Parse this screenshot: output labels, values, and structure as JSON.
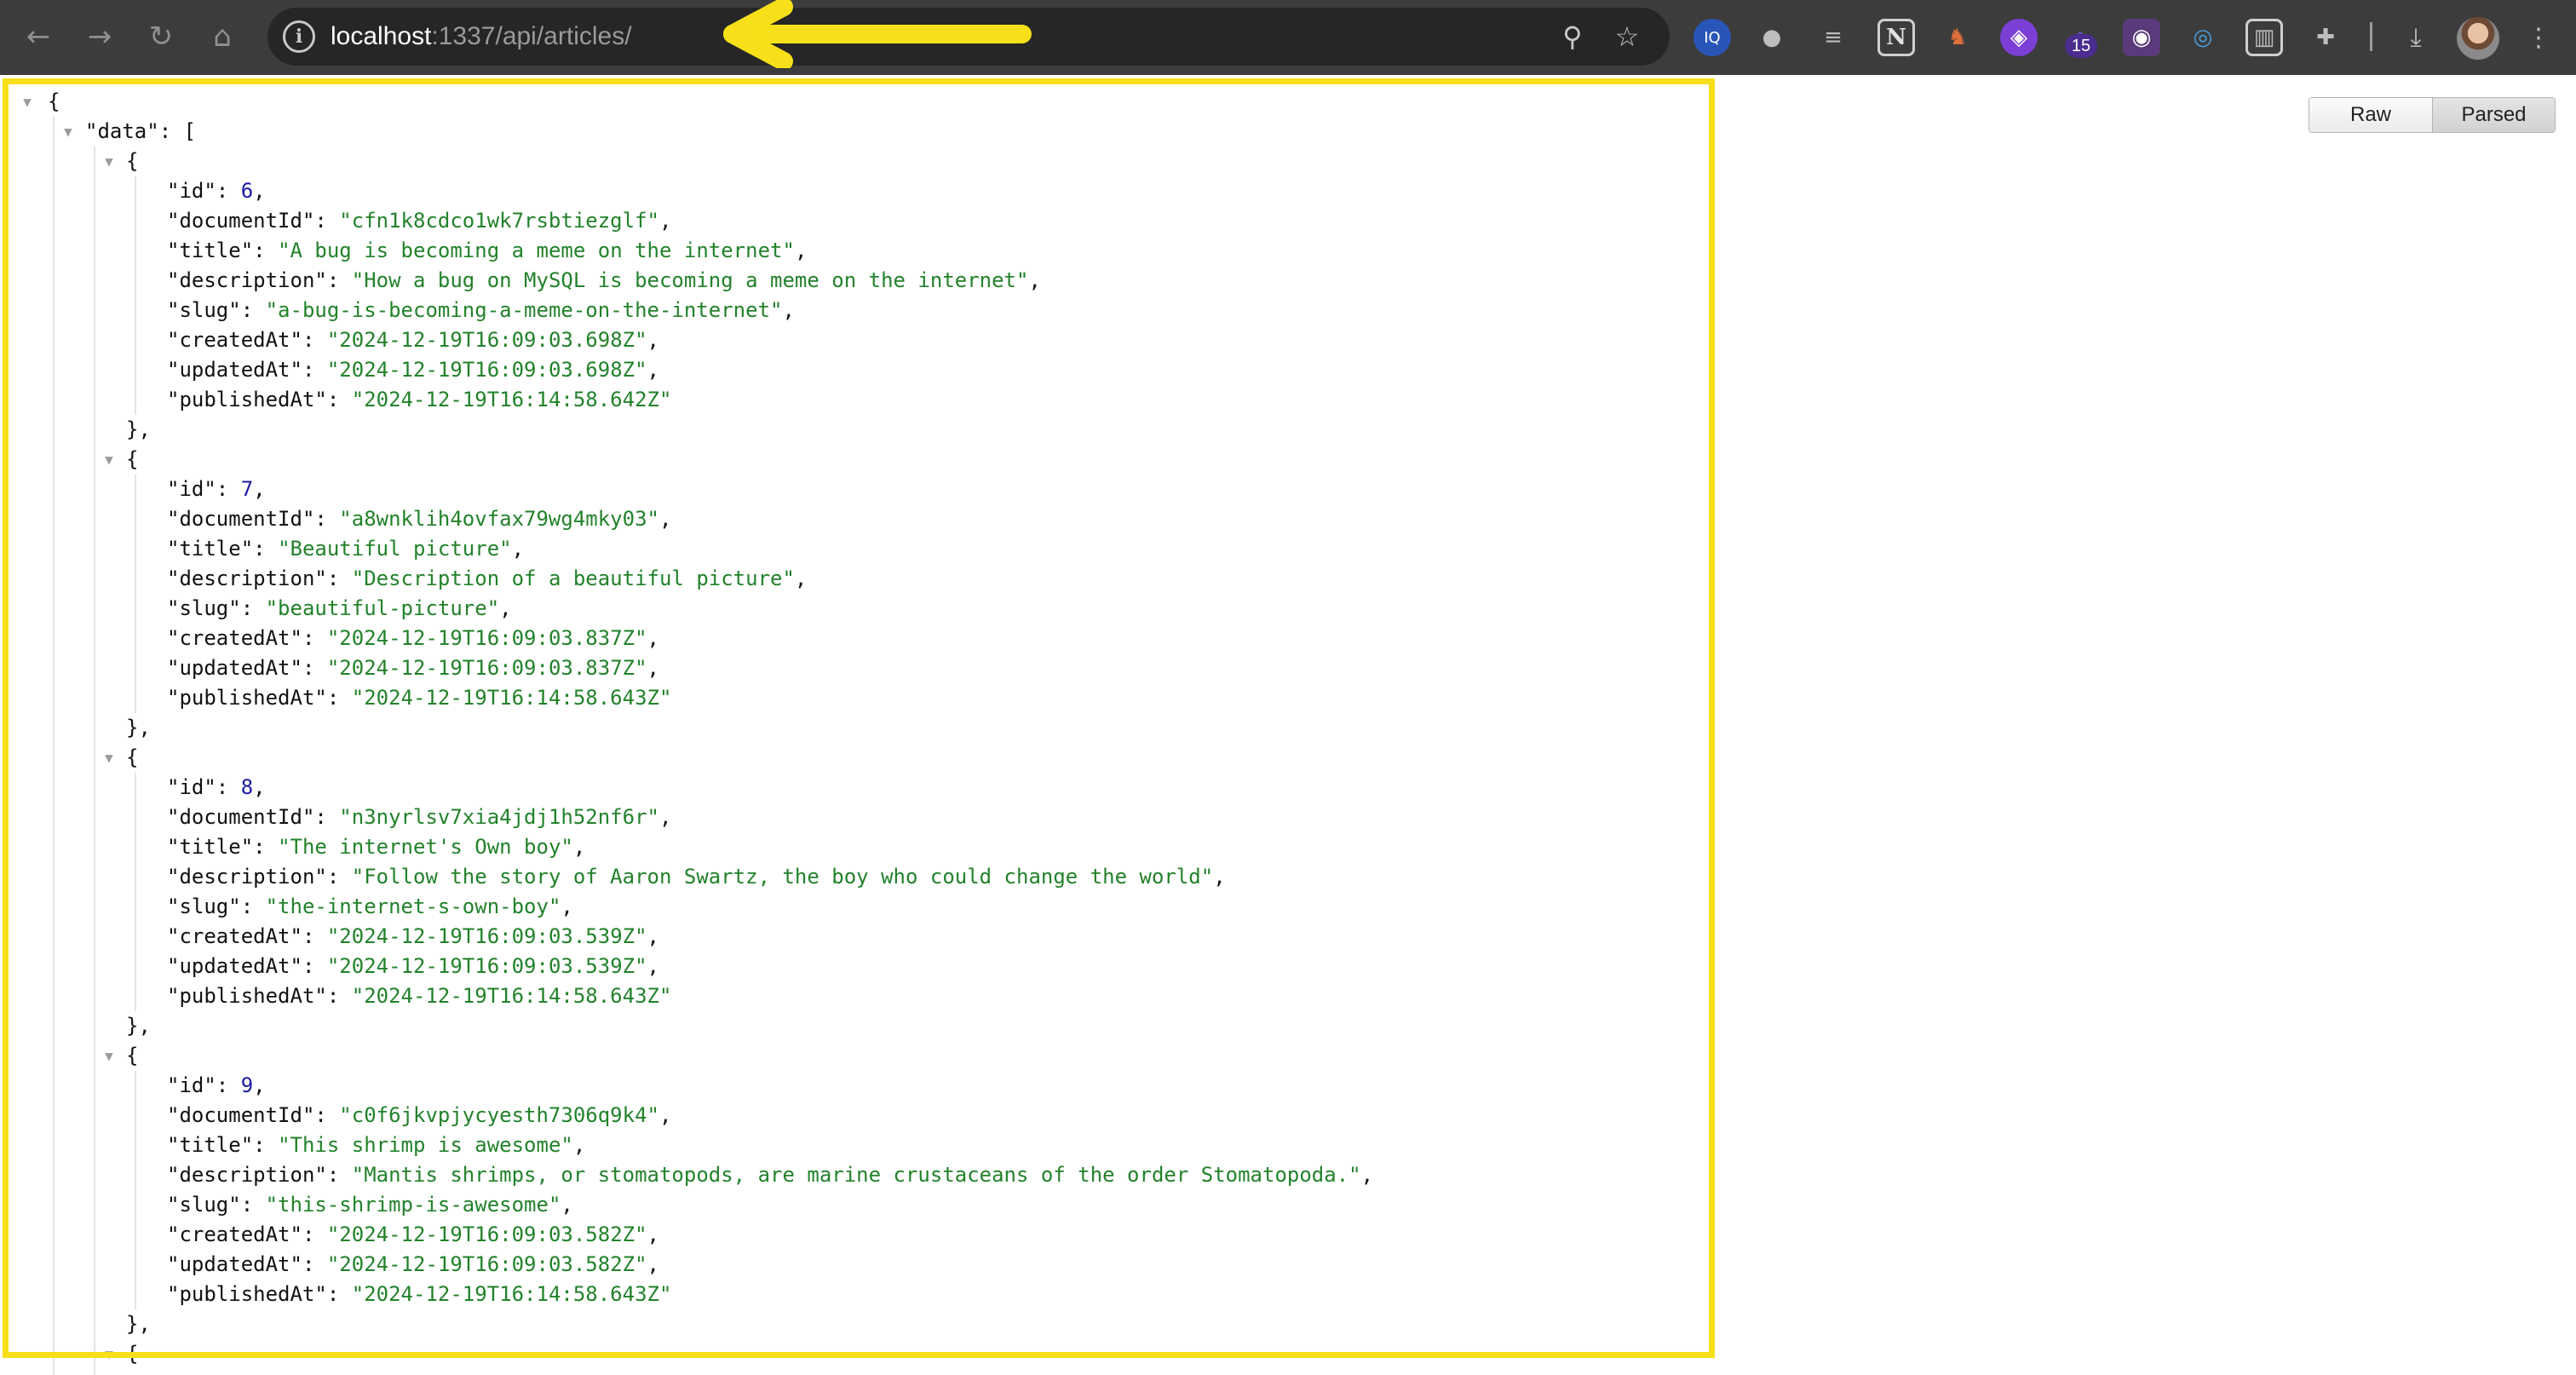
{
  "browser": {
    "url_host": "localhost",
    "url_path": ":1337/api/articles/",
    "extension_badge": "15",
    "nav_icons": [
      "back-arrow-icon",
      "forward-arrow-icon",
      "reload-icon",
      "home-icon"
    ],
    "colors": {
      "toolbar": "#3c3c3c",
      "omnibox": "#262626",
      "annotation": "#f7e019"
    }
  },
  "viewer": {
    "raw_label": "Raw",
    "parsed_label": "Parsed",
    "active_mode": "Parsed"
  },
  "json": {
    "open_brace": "{",
    "data_key": "\"data\"",
    "data_open": ": [",
    "articles": [
      {
        "id": "6",
        "documentId": "\"cfn1k8cdco1wk7rsbtiezglf\"",
        "title": "\"A bug is becoming a meme on the internet\"",
        "description": "\"How a bug on MySQL is becoming a meme on the internet\"",
        "slug": "\"a-bug-is-becoming-a-meme-on-the-internet\"",
        "createdAt": "\"2024-12-19T16:09:03.698Z\"",
        "updatedAt": "\"2024-12-19T16:09:03.698Z\"",
        "publishedAt": "\"2024-12-19T16:14:58.642Z\""
      },
      {
        "id": "7",
        "documentId": "\"a8wnklih4ovfax79wg4mky03\"",
        "title": "\"Beautiful picture\"",
        "description": "\"Description of a beautiful picture\"",
        "slug": "\"beautiful-picture\"",
        "createdAt": "\"2024-12-19T16:09:03.837Z\"",
        "updatedAt": "\"2024-12-19T16:09:03.837Z\"",
        "publishedAt": "\"2024-12-19T16:14:58.643Z\""
      },
      {
        "id": "8",
        "documentId": "\"n3nyrlsv7xia4jdj1h52nf6r\"",
        "title": "\"The internet's Own boy\"",
        "description": "\"Follow the story of Aaron Swartz, the boy who could change the world\"",
        "slug": "\"the-internet-s-own-boy\"",
        "createdAt": "\"2024-12-19T16:09:03.539Z\"",
        "updatedAt": "\"2024-12-19T16:09:03.539Z\"",
        "publishedAt": "\"2024-12-19T16:14:58.643Z\""
      },
      {
        "id": "9",
        "documentId": "\"c0f6jkvpjycyesth7306q9k4\"",
        "title": "\"This shrimp is awesome\"",
        "description": "\"Mantis shrimps, or stomatopods, are marine crustaceans of the order Stomatopoda.\"",
        "slug": "\"this-shrimp-is-awesome\"",
        "createdAt": "\"2024-12-19T16:09:03.582Z\"",
        "updatedAt": "\"2024-12-19T16:09:03.582Z\"",
        "publishedAt": "\"2024-12-19T16:14:58.643Z\""
      }
    ]
  }
}
